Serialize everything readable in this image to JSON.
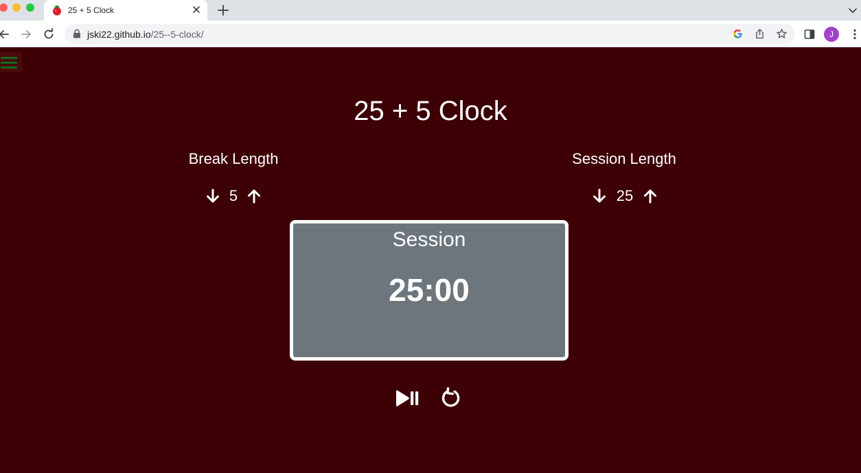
{
  "browser": {
    "tab_title": "25 + 5 Clock",
    "url_domain": "jski22.github.io",
    "url_path": "/25--5-clock/",
    "avatar_letter": "J",
    "avatar_color": "#a142c9"
  },
  "app": {
    "title": "25 + 5 Clock",
    "background_color": "#3c0005",
    "break": {
      "label": "Break Length",
      "value": "5"
    },
    "session": {
      "label": "Session Length",
      "value": "25"
    },
    "timer": {
      "label": "Session",
      "time_left": "25:00",
      "panel_color": "#6d757d"
    },
    "icons": {
      "menu": "hamburger-icon",
      "decrement": "arrow-down-icon",
      "increment": "arrow-up-icon",
      "start_stop": "play-pause-icon",
      "reset": "refresh-icon"
    }
  }
}
